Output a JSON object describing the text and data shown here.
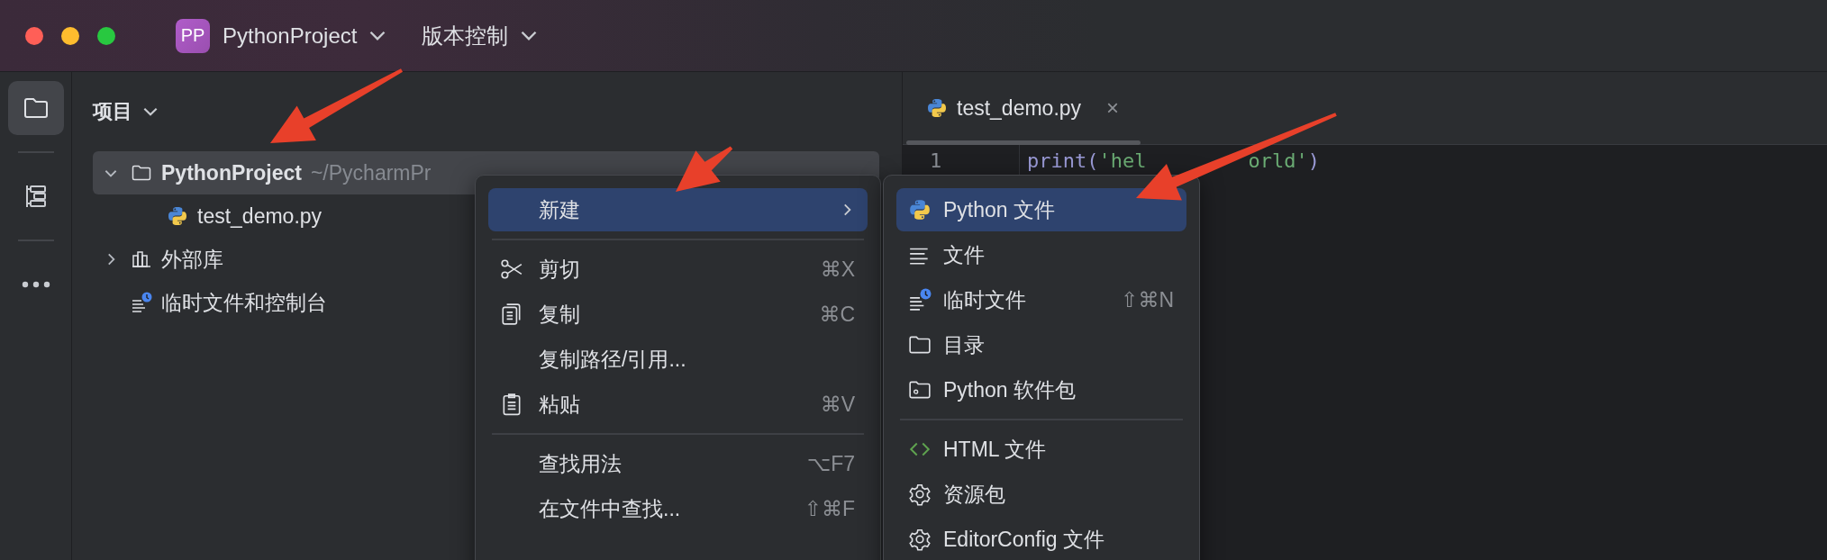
{
  "title_bar": {
    "project_badge": "PP",
    "project_name": "PythonProject",
    "vcs_menu": "版本控制"
  },
  "tool_strip": [
    {
      "kind": "project",
      "selected": true
    },
    {
      "kind": "structure",
      "selected": false
    },
    {
      "kind": "more",
      "selected": false
    }
  ],
  "project_panel": {
    "title": "项目",
    "tree": [
      {
        "kind": "folder",
        "label": "PythonProject",
        "path": "~/PycharmPr",
        "expanded": true,
        "selected": true,
        "children": [
          {
            "kind": "python",
            "label": "test_demo.py",
            "selected": false
          }
        ]
      },
      {
        "kind": "library",
        "label": "外部库",
        "expanded": false,
        "selected": false
      },
      {
        "kind": "scratch",
        "label": "临时文件和控制台",
        "selected": false
      }
    ]
  },
  "editor": {
    "tabs": [
      {
        "label": "test_demo.py",
        "close": "×",
        "selected": true
      }
    ],
    "lines": [
      {
        "number": "1",
        "code": [
          {
            "kind": "plain",
            "text": "print("
          },
          {
            "kind": "string",
            "text": "'hel"
          },
          {
            "kind": "hidden"
          },
          {
            "kind": "string",
            "text": "orld'"
          },
          {
            "kind": "plain",
            "text": ")"
          }
        ]
      }
    ]
  },
  "context_menu": {
    "items": [
      {
        "kind": "new",
        "label": "新建",
        "submenu": true,
        "selected": true
      },
      {
        "kind": "separator"
      },
      {
        "kind": "cut",
        "label": "剪切",
        "shortcut": "⌘X",
        "selected": false
      },
      {
        "kind": "copy",
        "label": "复制",
        "shortcut": "⌘C",
        "selected": false
      },
      {
        "kind": "copy_path",
        "label": "复制路径/引用...",
        "selected": false
      },
      {
        "kind": "paste",
        "label": "粘贴",
        "shortcut": "⌘V",
        "selected": false
      },
      {
        "kind": "separator"
      },
      {
        "kind": "find_usages",
        "label": "查找用法",
        "shortcut": "⌥F7",
        "selected": false
      },
      {
        "kind": "find_in_files",
        "label": "在文件中查找...",
        "shortcut": "⇧⌘F",
        "selected": false
      }
    ]
  },
  "submenu": {
    "items": [
      {
        "kind": "python_file",
        "label": "Python 文件",
        "selected": true
      },
      {
        "kind": "file",
        "label": "文件",
        "selected": false
      },
      {
        "kind": "scratch_file",
        "label": "临时文件",
        "shortcut": "⇧⌘N",
        "selected": false
      },
      {
        "kind": "directory",
        "label": "目录",
        "selected": false
      },
      {
        "kind": "python_package",
        "label": "Python 软件包",
        "selected": false
      },
      {
        "kind": "separator"
      },
      {
        "kind": "html_file",
        "label": "HTML 文件",
        "selected": false
      },
      {
        "kind": "resource_bundle",
        "label": "资源包",
        "selected": false
      },
      {
        "kind": "editorconfig",
        "label": "EditorConfig 文件",
        "selected": false
      }
    ]
  }
}
